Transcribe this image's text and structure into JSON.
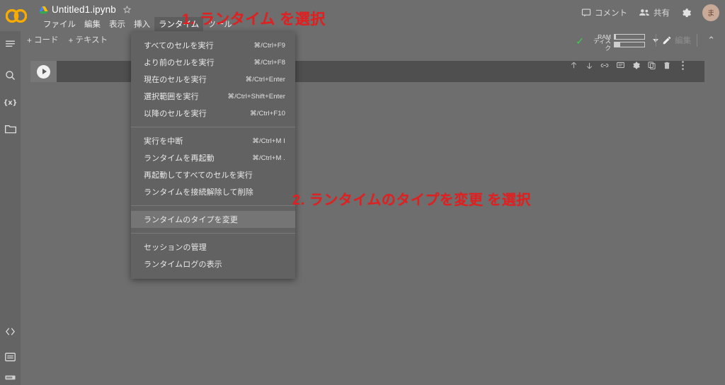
{
  "header": {
    "logo_name": "colab-logo",
    "drive_icon": "drive-icon",
    "doc_title": "Untitled1.ipynb",
    "star_icon": "star-icon",
    "menus": [
      {
        "label": "ファイル",
        "active": false
      },
      {
        "label": "編集",
        "active": false
      },
      {
        "label": "表示",
        "active": false
      },
      {
        "label": "挿入",
        "active": false
      },
      {
        "label": "ランタイム",
        "active": true
      },
      {
        "label": "ツール",
        "active": false
      }
    ],
    "comment_label": "コメント",
    "comment_icon": "comment-icon",
    "share_label": "共有",
    "share_icon": "people-icon",
    "settings_icon": "gear-icon",
    "avatar_initial": "ま"
  },
  "subbar": {
    "add_code_label": "コード",
    "add_text_label": "テキスト",
    "plus": "+",
    "connected_check": "✓",
    "ram_label": "RAM",
    "disk_label": "ディスク",
    "ram_fill_pct": "4%",
    "disk_fill_pct": "18%",
    "edit_label": "編集",
    "pencil_icon": "pencil-icon",
    "chevron_up_icon": "chevron-up-icon",
    "caret_down_icon": "caret-down-icon"
  },
  "rail": {
    "items": [
      {
        "name": "toc-icon"
      },
      {
        "name": "search-icon"
      },
      {
        "name": "variables-icon"
      },
      {
        "name": "files-folder-icon"
      }
    ],
    "bottom_items": [
      {
        "name": "code-snippets-icon"
      },
      {
        "name": "terminal-icon"
      },
      {
        "name": "command-palette-icon"
      }
    ]
  },
  "notebook": {
    "cell": {
      "run_button_icon": "run-play-icon",
      "toolbar_icons": [
        {
          "name": "move-cell-up-icon"
        },
        {
          "name": "move-cell-down-icon"
        },
        {
          "name": "link-to-cell-icon"
        },
        {
          "name": "add-comment-icon"
        },
        {
          "name": "cell-settings-icon"
        },
        {
          "name": "copy-cell-icon"
        },
        {
          "name": "delete-cell-icon"
        },
        {
          "name": "more-options-icon"
        }
      ]
    }
  },
  "runtime_menu": {
    "groups": [
      {
        "items": [
          {
            "label": "すべてのセルを実行",
            "shortcut": "⌘/Ctrl+F9",
            "highlight": false
          },
          {
            "label": "より前のセルを実行",
            "shortcut": "⌘/Ctrl+F8",
            "highlight": false
          },
          {
            "label": "現在のセルを実行",
            "shortcut": "⌘/Ctrl+Enter",
            "highlight": false
          },
          {
            "label": "選択範囲を実行",
            "shortcut": "⌘/Ctrl+Shift+Enter",
            "highlight": false
          },
          {
            "label": "以降のセルを実行",
            "shortcut": "⌘/Ctrl+F10",
            "highlight": false
          }
        ]
      },
      {
        "items": [
          {
            "label": "実行を中断",
            "shortcut": "⌘/Ctrl+M I",
            "highlight": false
          },
          {
            "label": "ランタイムを再起動",
            "shortcut": "⌘/Ctrl+M .",
            "highlight": false
          },
          {
            "label": "再起動してすべてのセルを実行",
            "shortcut": "",
            "highlight": false
          },
          {
            "label": "ランタイムを接続解除して削除",
            "shortcut": "",
            "highlight": false
          }
        ]
      },
      {
        "items": [
          {
            "label": "ランタイムのタイプを変更",
            "shortcut": "",
            "highlight": true
          }
        ]
      },
      {
        "items": [
          {
            "label": "セッションの管理",
            "shortcut": "",
            "highlight": false
          },
          {
            "label": "ランタイムログの表示",
            "shortcut": "",
            "highlight": false
          }
        ]
      }
    ]
  },
  "annotations": [
    {
      "text": "1. ランタイム を選択",
      "color": "#e02020"
    },
    {
      "text": "2. ランタイムのタイプを変更 を選択",
      "color": "#e02020"
    }
  ]
}
